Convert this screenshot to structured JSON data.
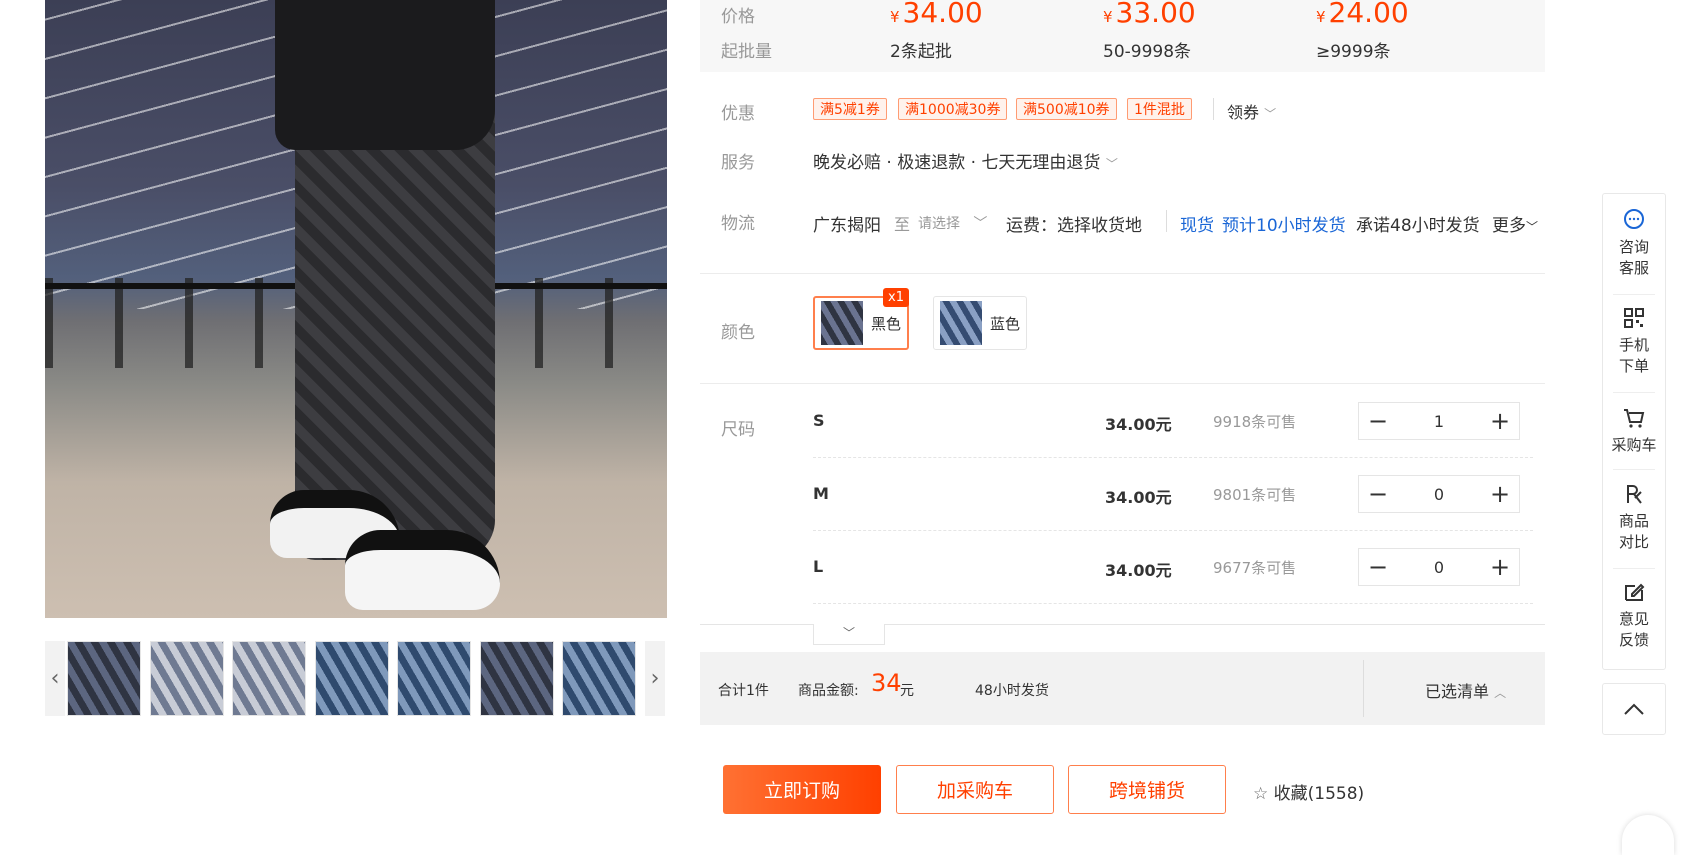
{
  "price": {
    "label_price": "价格",
    "label_moq": "起批量",
    "currency": "¥",
    "tiers": [
      {
        "price": "34.00",
        "moq": "2条起批"
      },
      {
        "price": "33.00",
        "moq": "50-9998条"
      },
      {
        "price": "24.00",
        "moq": "≥9999条"
      }
    ]
  },
  "promo": {
    "label": "优惠",
    "coupons": [
      "满5减1券",
      "满1000减30券",
      "满500减10券",
      "1件混批"
    ],
    "get_coupon": "领券"
  },
  "service": {
    "label": "服务",
    "text": "晚发必赔 · 极速退款 · 七天无理由退货"
  },
  "logistics": {
    "label": "物流",
    "origin": "广东揭阳",
    "to": "至",
    "select_placeholder": "请选择",
    "freight": "运费：选择收货地",
    "in_stock": "现货",
    "ship_estimate": "预计10小时发货",
    "promise": "承诺48小时发货",
    "more": "更多"
  },
  "color": {
    "label": "颜色",
    "options": [
      {
        "name": "黑色",
        "badge": "x1"
      },
      {
        "name": "蓝色"
      }
    ]
  },
  "size": {
    "label": "尺码",
    "rows": [
      {
        "name": "S",
        "price": "34.00元",
        "stock": "9918条可售",
        "qty": "1"
      },
      {
        "name": "M",
        "price": "34.00元",
        "stock": "9801条可售",
        "qty": "0"
      },
      {
        "name": "L",
        "price": "34.00元",
        "stock": "9677条可售",
        "qty": "0"
      }
    ]
  },
  "summary": {
    "total_count": "合计1件",
    "amount_label": "商品金额:",
    "amount_value": "34",
    "amount_unit": "元",
    "ship_text": "48小时发货",
    "selected_list": "已选清单"
  },
  "actions": {
    "buy_now": "立即订购",
    "add_cart": "加采购车",
    "cross_border": "跨境铺货",
    "favorite": "收藏(1558)"
  },
  "sidebar": {
    "items": [
      {
        "line1": "咨询",
        "line2": "客服"
      },
      {
        "line1": "手机",
        "line2": "下单"
      },
      {
        "line1": "采购车",
        "line2": ""
      },
      {
        "line1": "商品",
        "line2": "对比"
      },
      {
        "line1": "意见",
        "line2": "反馈"
      }
    ]
  },
  "colors": {
    "accent": "#ff4000",
    "link": "#1a66d6"
  }
}
